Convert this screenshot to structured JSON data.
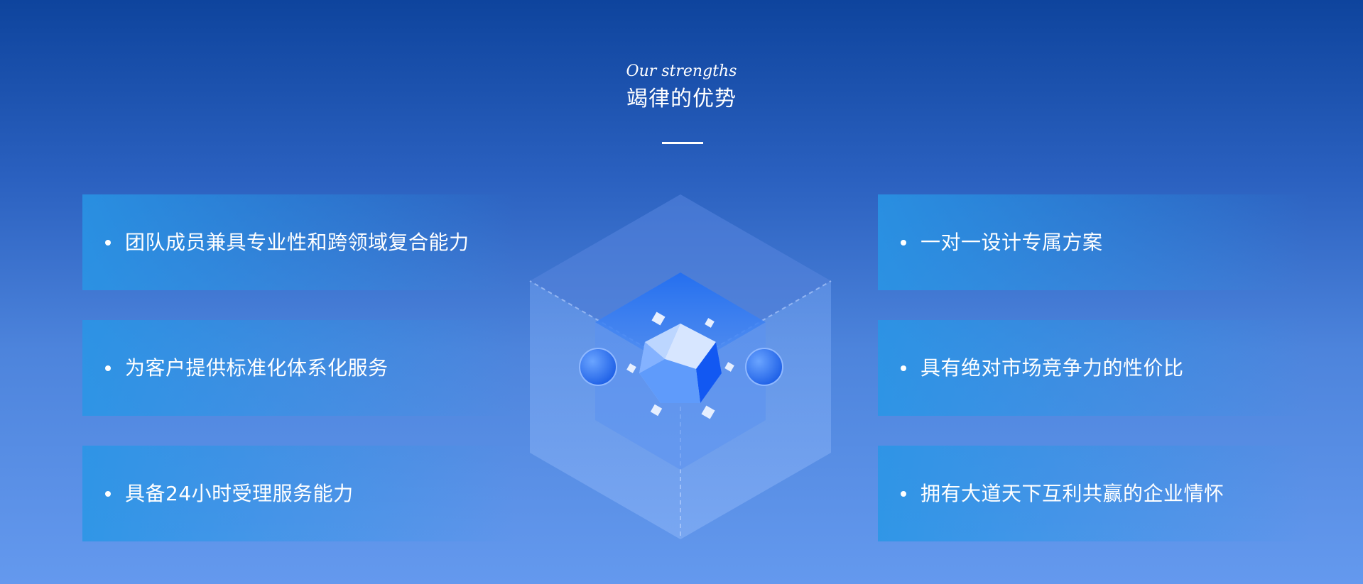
{
  "header": {
    "subtitle": "Our strengths",
    "title": "竭律的优势"
  },
  "strengths": {
    "left": [
      {
        "text": "团队成员兼具专业性和跨领域复合能力"
      },
      {
        "text": "为客户提供标准化体系化服务"
      },
      {
        "text": "具备24小时受理服务能力"
      }
    ],
    "right": [
      {
        "text": "一对一设计专属方案"
      },
      {
        "text": "具有绝对市场竞争力的性价比"
      },
      {
        "text": "拥有大道天下互利共赢的企业情怀"
      }
    ]
  },
  "colors": {
    "background_top": "#0e449d",
    "background_bottom": "#6499ee",
    "card_accent": "#2896e6",
    "crystal": "#1e6ef5"
  },
  "icons": {
    "center_graphic": "crystal-cube-icon"
  }
}
